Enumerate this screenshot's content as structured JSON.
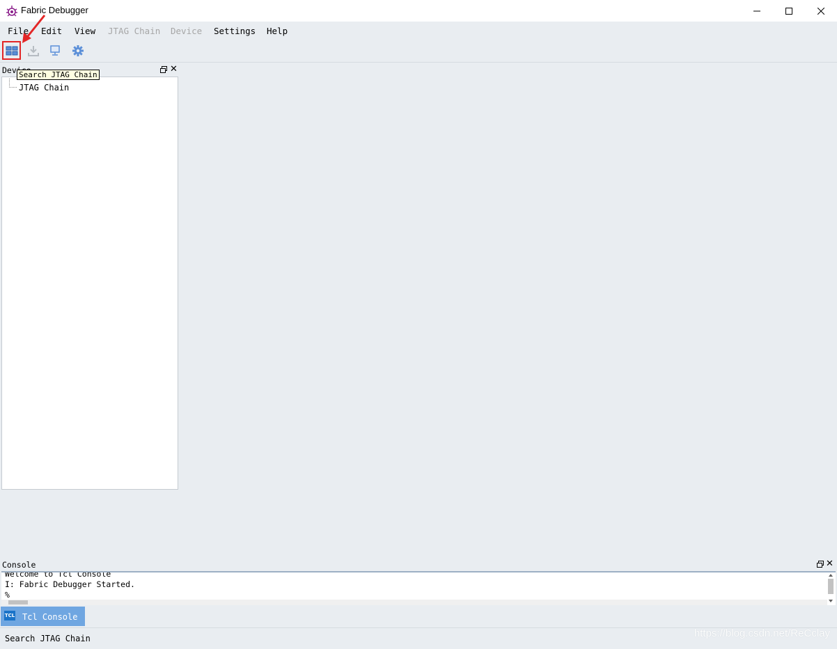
{
  "window": {
    "title": "Fabric Debugger"
  },
  "menu": [
    {
      "label": "File",
      "enabled": true
    },
    {
      "label": "Edit",
      "enabled": true
    },
    {
      "label": "View",
      "enabled": true
    },
    {
      "label": "JTAG Chain",
      "enabled": false
    },
    {
      "label": "Device",
      "enabled": false
    },
    {
      "label": "Settings",
      "enabled": true
    },
    {
      "label": "Help",
      "enabled": true
    }
  ],
  "toolbar": {
    "buttons": [
      {
        "icon": "search-jtag-chain-icon",
        "enabled": true
      },
      {
        "icon": "download-icon",
        "enabled": false
      },
      {
        "icon": "monitor-icon",
        "enabled": true
      },
      {
        "icon": "gear-icon",
        "enabled": true
      }
    ],
    "tooltip": "Search JTAG Chain"
  },
  "device_panel": {
    "title": "Device",
    "tree": [
      "JTAG Chain"
    ]
  },
  "console_panel": {
    "title": "Console",
    "lines": [
      "Welcome to Tcl Console",
      "I: Fabric Debugger Started.",
      "%"
    ],
    "tab_label": "Tcl Console",
    "tab_icon_text": "TCL"
  },
  "status": {
    "text": "Search JTAG Chain"
  },
  "watermark": "https://blog.csdn.net/ReCclay",
  "colors": {
    "accent": "#6fa6e1",
    "annotation": "#e32626",
    "background": "#e9edf1"
  }
}
